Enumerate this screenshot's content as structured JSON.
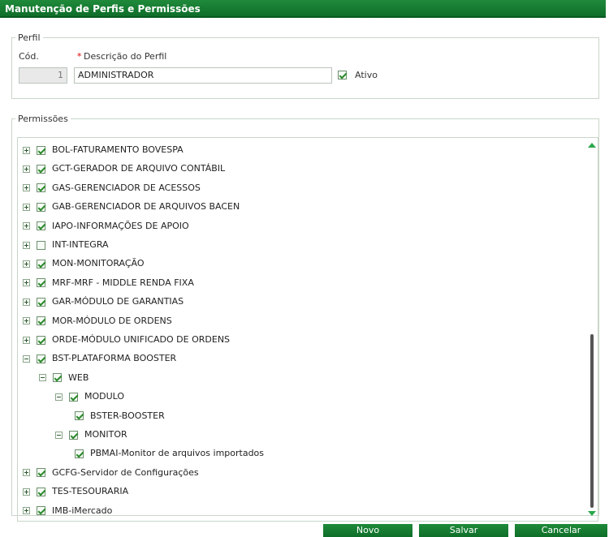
{
  "window": {
    "title": "Manutenção de Perfis e Permissões"
  },
  "perfil": {
    "legend": "Perfil",
    "cod_label": "Cód.",
    "desc_required": "*",
    "desc_label": "Descrição do Perfil",
    "cod_value": "1",
    "desc_value": "ADMINISTRADOR",
    "ativo_label": "Ativo",
    "ativo_checked": true
  },
  "permissoes": {
    "legend": "Permissões",
    "tree": [
      {
        "label": "BOL-FATURAMENTO BOVESPA",
        "level": 0,
        "expander": "plus",
        "checked": true
      },
      {
        "label": "GCT-GERADOR DE ARQUIVO CONTÁBIL",
        "level": 0,
        "expander": "plus",
        "checked": true
      },
      {
        "label": "GAS-GERENCIADOR DE ACESSOS",
        "level": 0,
        "expander": "plus",
        "checked": true
      },
      {
        "label": "GAB-GERENCIADOR DE ARQUIVOS BACEN",
        "level": 0,
        "expander": "plus",
        "checked": true
      },
      {
        "label": "IAPO-INFORMAÇÕES DE APOIO",
        "level": 0,
        "expander": "plus",
        "checked": true
      },
      {
        "label": "INT-INTEGRA",
        "level": 0,
        "expander": "plus",
        "checked": false
      },
      {
        "label": "MON-MONITORAÇÃO",
        "level": 0,
        "expander": "plus",
        "checked": true
      },
      {
        "label": "MRF-MRF - MIDDLE RENDA FIXA",
        "level": 0,
        "expander": "plus",
        "checked": true
      },
      {
        "label": "GAR-MÓDULO DE GARANTIAS",
        "level": 0,
        "expander": "plus",
        "checked": true
      },
      {
        "label": "MOR-MÓDULO DE ORDENS",
        "level": 0,
        "expander": "plus",
        "checked": true
      },
      {
        "label": "ORDE-MÓDULO UNIFICADO DE ORDENS",
        "level": 0,
        "expander": "plus",
        "checked": true
      },
      {
        "label": "BST-PLATAFORMA BOOSTER",
        "level": 0,
        "expander": "minus",
        "checked": true
      },
      {
        "label": "WEB",
        "level": 1,
        "expander": "minus",
        "checked": true
      },
      {
        "label": "MODULO",
        "level": 2,
        "expander": "minus",
        "checked": true
      },
      {
        "label": "BSTER-BOOSTER",
        "level": 3,
        "expander": "none",
        "checked": true
      },
      {
        "label": "MONITOR",
        "level": 2,
        "expander": "minus",
        "checked": true
      },
      {
        "label": "PBMAI-Monitor de arquivos importados",
        "level": 3,
        "expander": "none",
        "checked": true
      },
      {
        "label": "GCFG-Servidor de Configurações",
        "level": 0,
        "expander": "plus",
        "checked": true
      },
      {
        "label": "TES-TESOURARIA",
        "level": 0,
        "expander": "plus",
        "checked": true
      },
      {
        "label": "IMB-iMercado",
        "level": 0,
        "expander": "plus",
        "checked": true
      }
    ]
  },
  "footer": {
    "novo_label": "Novo",
    "salvar_label": "Salvar",
    "cancelar_label": "Cancelar"
  }
}
